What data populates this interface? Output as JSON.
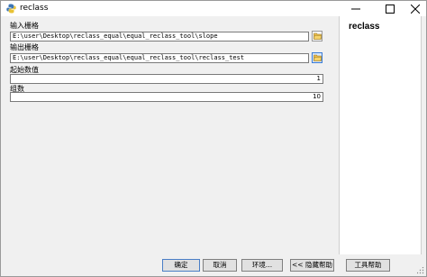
{
  "window": {
    "title": "reclass"
  },
  "form": {
    "input_raster_label": "输入栅格",
    "input_raster_value": "E:\\user\\Desktop\\reclass_equal\\equal_reclass_tool\\slope",
    "output_raster_label": "输出栅格",
    "output_raster_value": "E:\\user\\Desktop\\reclass_equal\\equal_reclass_tool\\reclass_test",
    "start_value_label": "起始数值",
    "start_value": "1",
    "group_count_label": "组数",
    "group_count": "10"
  },
  "help": {
    "title": "reclass"
  },
  "buttons": {
    "ok": "确定",
    "cancel": "取消",
    "environments": "环境...",
    "hide_help": "<< 隐藏帮助",
    "tool_help": "工具帮助"
  },
  "icons": {
    "app": "python-tool-icon",
    "folder": "open-folder-icon"
  },
  "colors": {
    "title_bg": "#ffffff",
    "form_bg": "#f0f0f0",
    "ok_border": "#4a7ec6",
    "folder_active": "#dbe9fb"
  }
}
